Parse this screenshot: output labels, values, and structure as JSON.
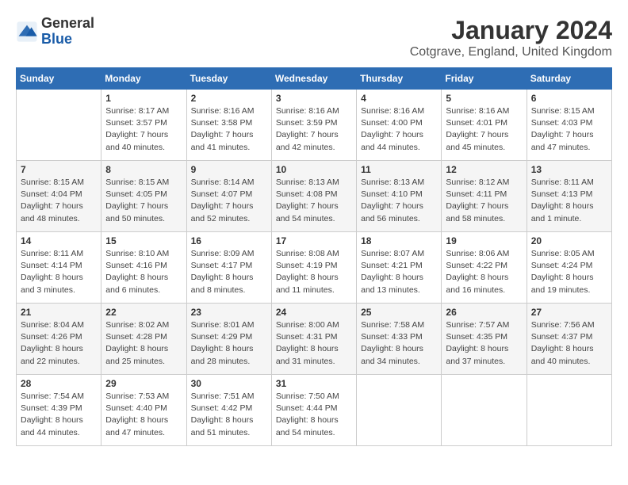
{
  "header": {
    "logo_general": "General",
    "logo_blue": "Blue",
    "month_title": "January 2024",
    "location": "Cotgrave, England, United Kingdom"
  },
  "weekdays": [
    "Sunday",
    "Monday",
    "Tuesday",
    "Wednesday",
    "Thursday",
    "Friday",
    "Saturday"
  ],
  "weeks": [
    [
      {
        "day": "",
        "info": ""
      },
      {
        "day": "1",
        "info": "Sunrise: 8:17 AM\nSunset: 3:57 PM\nDaylight: 7 hours\nand 40 minutes."
      },
      {
        "day": "2",
        "info": "Sunrise: 8:16 AM\nSunset: 3:58 PM\nDaylight: 7 hours\nand 41 minutes."
      },
      {
        "day": "3",
        "info": "Sunrise: 8:16 AM\nSunset: 3:59 PM\nDaylight: 7 hours\nand 42 minutes."
      },
      {
        "day": "4",
        "info": "Sunrise: 8:16 AM\nSunset: 4:00 PM\nDaylight: 7 hours\nand 44 minutes."
      },
      {
        "day": "5",
        "info": "Sunrise: 8:16 AM\nSunset: 4:01 PM\nDaylight: 7 hours\nand 45 minutes."
      },
      {
        "day": "6",
        "info": "Sunrise: 8:15 AM\nSunset: 4:03 PM\nDaylight: 7 hours\nand 47 minutes."
      }
    ],
    [
      {
        "day": "7",
        "info": "Sunrise: 8:15 AM\nSunset: 4:04 PM\nDaylight: 7 hours\nand 48 minutes."
      },
      {
        "day": "8",
        "info": "Sunrise: 8:15 AM\nSunset: 4:05 PM\nDaylight: 7 hours\nand 50 minutes."
      },
      {
        "day": "9",
        "info": "Sunrise: 8:14 AM\nSunset: 4:07 PM\nDaylight: 7 hours\nand 52 minutes."
      },
      {
        "day": "10",
        "info": "Sunrise: 8:13 AM\nSunset: 4:08 PM\nDaylight: 7 hours\nand 54 minutes."
      },
      {
        "day": "11",
        "info": "Sunrise: 8:13 AM\nSunset: 4:10 PM\nDaylight: 7 hours\nand 56 minutes."
      },
      {
        "day": "12",
        "info": "Sunrise: 8:12 AM\nSunset: 4:11 PM\nDaylight: 7 hours\nand 58 minutes."
      },
      {
        "day": "13",
        "info": "Sunrise: 8:11 AM\nSunset: 4:13 PM\nDaylight: 8 hours\nand 1 minute."
      }
    ],
    [
      {
        "day": "14",
        "info": "Sunrise: 8:11 AM\nSunset: 4:14 PM\nDaylight: 8 hours\nand 3 minutes."
      },
      {
        "day": "15",
        "info": "Sunrise: 8:10 AM\nSunset: 4:16 PM\nDaylight: 8 hours\nand 6 minutes."
      },
      {
        "day": "16",
        "info": "Sunrise: 8:09 AM\nSunset: 4:17 PM\nDaylight: 8 hours\nand 8 minutes."
      },
      {
        "day": "17",
        "info": "Sunrise: 8:08 AM\nSunset: 4:19 PM\nDaylight: 8 hours\nand 11 minutes."
      },
      {
        "day": "18",
        "info": "Sunrise: 8:07 AM\nSunset: 4:21 PM\nDaylight: 8 hours\nand 13 minutes."
      },
      {
        "day": "19",
        "info": "Sunrise: 8:06 AM\nSunset: 4:22 PM\nDaylight: 8 hours\nand 16 minutes."
      },
      {
        "day": "20",
        "info": "Sunrise: 8:05 AM\nSunset: 4:24 PM\nDaylight: 8 hours\nand 19 minutes."
      }
    ],
    [
      {
        "day": "21",
        "info": "Sunrise: 8:04 AM\nSunset: 4:26 PM\nDaylight: 8 hours\nand 22 minutes."
      },
      {
        "day": "22",
        "info": "Sunrise: 8:02 AM\nSunset: 4:28 PM\nDaylight: 8 hours\nand 25 minutes."
      },
      {
        "day": "23",
        "info": "Sunrise: 8:01 AM\nSunset: 4:29 PM\nDaylight: 8 hours\nand 28 minutes."
      },
      {
        "day": "24",
        "info": "Sunrise: 8:00 AM\nSunset: 4:31 PM\nDaylight: 8 hours\nand 31 minutes."
      },
      {
        "day": "25",
        "info": "Sunrise: 7:58 AM\nSunset: 4:33 PM\nDaylight: 8 hours\nand 34 minutes."
      },
      {
        "day": "26",
        "info": "Sunrise: 7:57 AM\nSunset: 4:35 PM\nDaylight: 8 hours\nand 37 minutes."
      },
      {
        "day": "27",
        "info": "Sunrise: 7:56 AM\nSunset: 4:37 PM\nDaylight: 8 hours\nand 40 minutes."
      }
    ],
    [
      {
        "day": "28",
        "info": "Sunrise: 7:54 AM\nSunset: 4:39 PM\nDaylight: 8 hours\nand 44 minutes."
      },
      {
        "day": "29",
        "info": "Sunrise: 7:53 AM\nSunset: 4:40 PM\nDaylight: 8 hours\nand 47 minutes."
      },
      {
        "day": "30",
        "info": "Sunrise: 7:51 AM\nSunset: 4:42 PM\nDaylight: 8 hours\nand 51 minutes."
      },
      {
        "day": "31",
        "info": "Sunrise: 7:50 AM\nSunset: 4:44 PM\nDaylight: 8 hours\nand 54 minutes."
      },
      {
        "day": "",
        "info": ""
      },
      {
        "day": "",
        "info": ""
      },
      {
        "day": "",
        "info": ""
      }
    ]
  ]
}
